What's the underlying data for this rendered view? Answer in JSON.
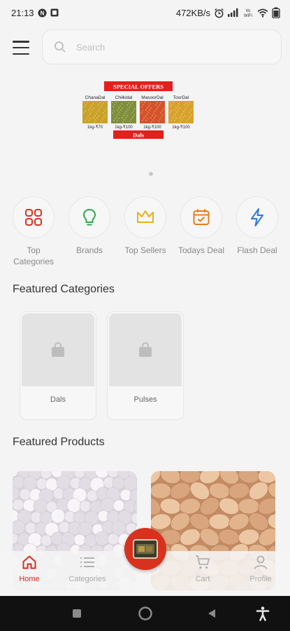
{
  "status_bar": {
    "time": "21:13",
    "network_speed": "472KB/s",
    "icons": [
      "notification-n-icon",
      "app-square-icon",
      "alarm-icon",
      "signal-icon",
      "vowifi-icon",
      "wifi-icon",
      "battery-icon"
    ],
    "vowifi_label": "Vo\nWiFi"
  },
  "header": {
    "menu_icon": "hamburger-icon",
    "search_placeholder": "Search"
  },
  "banner": {
    "headline": "SPECIAL OFFERS",
    "footer": "Dals",
    "items": [
      {
        "name": "ChanaDal",
        "price": "1kg-₹70",
        "color": "#c9a227"
      },
      {
        "name": "Chilkidal",
        "price": "1kg-₹100",
        "color": "#7f8f3a"
      },
      {
        "name": "MasoorDal",
        "price": "1kg-₹100",
        "color": "#d5532a"
      },
      {
        "name": "ToorDal",
        "price": "1kg-₹100",
        "color": "#d9a12b"
      }
    ],
    "accent": "#e3201b"
  },
  "quick_menu": [
    {
      "label": "Top\nCategories",
      "icon": "categories-grid-icon",
      "color": "#d8311d"
    },
    {
      "label": "Brands",
      "icon": "lightbulb-icon",
      "color": "#2fa84f"
    },
    {
      "label": "Top Sellers",
      "icon": "crown-icon",
      "color": "#e7b21a"
    },
    {
      "label": "Todays Deal",
      "icon": "calendar-check-icon",
      "color": "#e87b1c"
    },
    {
      "label": "Flash Deal",
      "icon": "lightning-icon",
      "color": "#2e7bdc"
    }
  ],
  "featured_categories": {
    "title": "Featured Categories",
    "items": [
      {
        "label": "Dals"
      },
      {
        "label": "Pulses"
      }
    ]
  },
  "featured_products": {
    "title": "Featured Products",
    "items": [
      {
        "image": "sabudana-pearls",
        "color": "#e8e3ea"
      },
      {
        "image": "peanuts",
        "color": "#d9a983"
      }
    ]
  },
  "bottom_nav": {
    "items": [
      {
        "label": "Home",
        "icon": "home-icon",
        "active": true
      },
      {
        "label": "Categories",
        "icon": "list-icon",
        "active": false
      },
      {
        "label": "Cart",
        "icon": "cart-icon",
        "active": false
      },
      {
        "label": "Profile",
        "icon": "user-icon",
        "active": false
      }
    ],
    "active_color": "#d32f1e",
    "fab_icon": "shop-logo-icon"
  },
  "system_nav": {
    "icons": [
      "recents-icon",
      "home-circle-icon",
      "back-icon",
      "accessibility-icon"
    ]
  }
}
